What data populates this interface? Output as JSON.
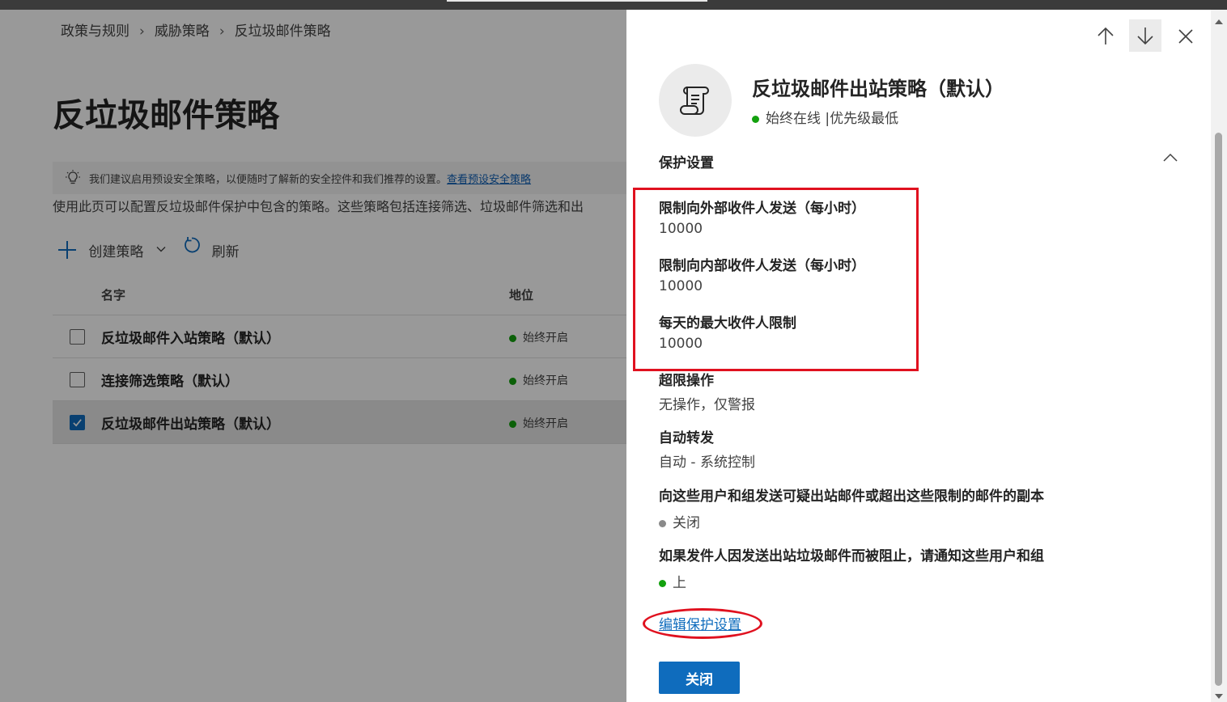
{
  "breadcrumb": [
    "政策与规则",
    "威胁策略",
    "反垃圾邮件策略"
  ],
  "page": {
    "title": "反垃圾邮件策略",
    "info_text": "我们建议启用预设安全策略，以便随时了解新的安全控件和我们推荐的设置。",
    "info_link": "查看预设安全策略",
    "description": "使用此页可以配置反垃圾邮件保护中包含的策略。这些策略包括连接筛选、垃圾邮件筛选和出",
    "toolbar": {
      "create": "创建策略",
      "refresh": "刷新"
    },
    "table": {
      "headers": [
        "名字",
        "地位"
      ],
      "rows": [
        {
          "name": "反垃圾邮件入站策略（默认）",
          "status": "始终开启",
          "checked": false
        },
        {
          "name": "连接筛选策略（默认）",
          "status": "始终开启",
          "checked": false
        },
        {
          "name": "反垃圾邮件出站策略（默认）",
          "status": "始终开启",
          "checked": true
        }
      ]
    }
  },
  "panel": {
    "title": "反垃圾邮件出站策略（默认）",
    "subtitle": "始终在线 |优先级最低",
    "section": "保护设置",
    "fields": [
      {
        "label": "限制向外部收件人发送（每小时）",
        "value": "10000"
      },
      {
        "label": "限制向内部收件人发送（每小时）",
        "value": "10000"
      },
      {
        "label": "每天的最大收件人限制",
        "value": "10000"
      },
      {
        "label": "超限操作",
        "value": "无操作，仅警报"
      },
      {
        "label": "自动转发",
        "value": "自动 - 系统控制"
      },
      {
        "label": "向这些用户和组发送可疑出站邮件或超出这些限制的邮件的副本",
        "value": "关闭",
        "status": "gray"
      },
      {
        "label": "如果发件人因发送出站垃圾邮件而被阻止，请通知这些用户和组",
        "value": "上",
        "status": "green"
      }
    ],
    "edit_link": "编辑保护设置",
    "close_button": "关闭"
  },
  "colors": {
    "accent": "#0f6cbd",
    "status_green": "#13a10e",
    "status_gray": "#8a8a8a",
    "annotation_red": "#e0111f"
  }
}
